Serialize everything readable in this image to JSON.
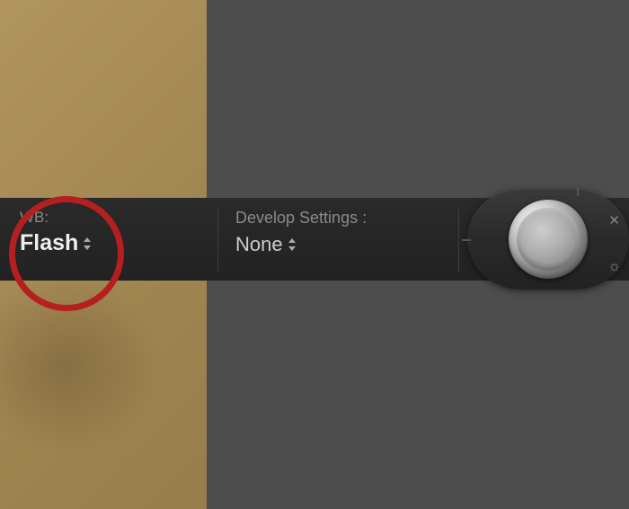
{
  "wb": {
    "label": "WB:",
    "value": "Flash"
  },
  "develop": {
    "label": "Develop Settings :",
    "value": "None"
  },
  "icons": {
    "close": "✕",
    "gear": "☼"
  }
}
